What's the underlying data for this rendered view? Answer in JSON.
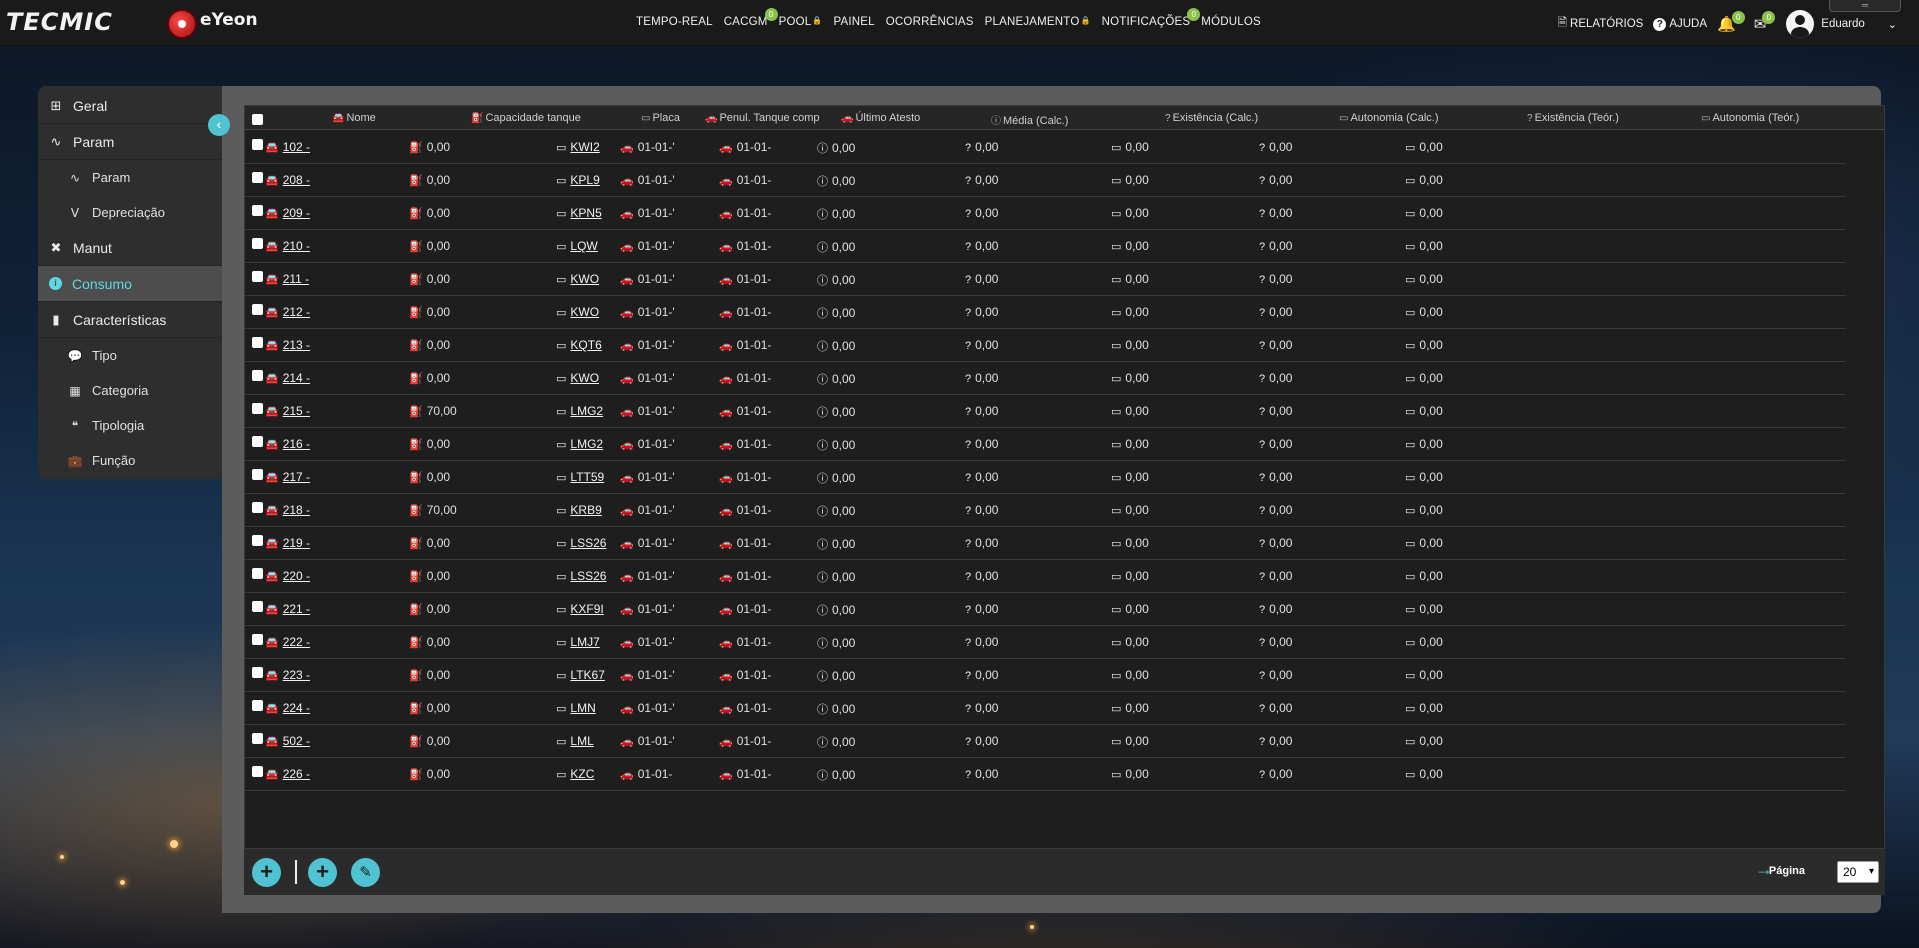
{
  "brand": {
    "tecmic": "TECMIC",
    "eyeon": "eYeon"
  },
  "topnav": [
    {
      "label": "TEMPO-REAL",
      "badge": ""
    },
    {
      "label": "CACGM",
      "badge": "0"
    },
    {
      "label": "POOL",
      "badge": ""
    },
    {
      "label": "PAINEL",
      "badge": ""
    },
    {
      "label": "OCORRÊNCIAS",
      "badge": ""
    },
    {
      "label": "PLANEJAMENTO",
      "badge": ""
    },
    {
      "label": "NOTIFICAÇÕES",
      "badge": "0"
    },
    {
      "label": "MÓDULOS",
      "badge": ""
    }
  ],
  "topright": {
    "reports": "RELATÓRIOS",
    "help": "AJUDA",
    "bell_badge": "0",
    "mail_badge": "0",
    "user": "Eduardo"
  },
  "sidebar": {
    "geral": "Geral",
    "param": "Param",
    "param_sub": "Param",
    "depreciacao": "Depreciação",
    "manut": "Manut",
    "consumo": "Consumo",
    "caracteristicas": "Características",
    "tipo": "Tipo",
    "categoria": "Categoria",
    "tipologia": "Tipologia",
    "funcao": "Função"
  },
  "table": {
    "headers": {
      "nome": "Nome",
      "capacidade": "Capacidade tanque",
      "placa": "Placa",
      "penul": "Penul. Tanque comp",
      "ultimo": "Último Atesto",
      "media": "Média (Calc.)",
      "existencia_calc": "Existência (Calc.)",
      "autonomia_calc": "Autonomia (Calc.)",
      "existencia_teor": "Existência (Teór.)",
      "autonomia_teor": "Autonomia (Teór.)"
    },
    "rows": [
      {
        "nome": "102 -",
        "capacidade": "0,00",
        "placa": "KWI2",
        "penul": "01-01-'",
        "ultimo": "01-01-",
        "media": "0,00",
        "ex_calc": "0,00",
        "aut_calc": "0,00",
        "ex_teor": "0,00",
        "aut_teor": "0,00"
      },
      {
        "nome": "208 -",
        "capacidade": "0,00",
        "placa": "KPL9",
        "penul": "01-01-'",
        "ultimo": "01-01-",
        "media": "0,00",
        "ex_calc": "0,00",
        "aut_calc": "0,00",
        "ex_teor": "0,00",
        "aut_teor": "0,00"
      },
      {
        "nome": "209 -",
        "capacidade": "0,00",
        "placa": "KPN5",
        "penul": "01-01-'",
        "ultimo": "01-01-",
        "media": "0,00",
        "ex_calc": "0,00",
        "aut_calc": "0,00",
        "ex_teor": "0,00",
        "aut_teor": "0,00"
      },
      {
        "nome": "210 -",
        "capacidade": "0,00",
        "placa": "LQW",
        "penul": "01-01-'",
        "ultimo": "01-01-",
        "media": "0,00",
        "ex_calc": "0,00",
        "aut_calc": "0,00",
        "ex_teor": "0,00",
        "aut_teor": "0,00"
      },
      {
        "nome": "211 -",
        "capacidade": "0,00",
        "placa": "KWO",
        "penul": "01-01-'",
        "ultimo": "01-01-",
        "media": "0,00",
        "ex_calc": "0,00",
        "aut_calc": "0,00",
        "ex_teor": "0,00",
        "aut_teor": "0,00"
      },
      {
        "nome": "212 -",
        "capacidade": "0,00",
        "placa": "KWO",
        "penul": "01-01-'",
        "ultimo": "01-01-",
        "media": "0,00",
        "ex_calc": "0,00",
        "aut_calc": "0,00",
        "ex_teor": "0,00",
        "aut_teor": "0,00"
      },
      {
        "nome": "213 -",
        "capacidade": "0,00",
        "placa": "KQT6",
        "penul": "01-01-'",
        "ultimo": "01-01-",
        "media": "0,00",
        "ex_calc": "0,00",
        "aut_calc": "0,00",
        "ex_teor": "0,00",
        "aut_teor": "0,00"
      },
      {
        "nome": "214 -",
        "capacidade": "0,00",
        "placa": "KWO",
        "penul": "01-01-'",
        "ultimo": "01-01-",
        "media": "0,00",
        "ex_calc": "0,00",
        "aut_calc": "0,00",
        "ex_teor": "0,00",
        "aut_teor": "0,00"
      },
      {
        "nome": "215 -",
        "capacidade": "70,00",
        "placa": "LMG2",
        "penul": "01-01-'",
        "ultimo": "01-01-",
        "media": "0,00",
        "ex_calc": "0,00",
        "aut_calc": "0,00",
        "ex_teor": "0,00",
        "aut_teor": "0,00"
      },
      {
        "nome": "216 -",
        "capacidade": "0,00",
        "placa": "LMG2",
        "penul": "01-01-'",
        "ultimo": "01-01-",
        "media": "0,00",
        "ex_calc": "0,00",
        "aut_calc": "0,00",
        "ex_teor": "0,00",
        "aut_teor": "0,00"
      },
      {
        "nome": "217 -",
        "capacidade": "0,00",
        "placa": "LTT59",
        "penul": "01-01-'",
        "ultimo": "01-01-",
        "media": "0,00",
        "ex_calc": "0,00",
        "aut_calc": "0,00",
        "ex_teor": "0,00",
        "aut_teor": "0,00"
      },
      {
        "nome": "218 -",
        "capacidade": "70,00",
        "placa": "KRB9",
        "penul": "01-01-'",
        "ultimo": "01-01-",
        "media": "0,00",
        "ex_calc": "0,00",
        "aut_calc": "0,00",
        "ex_teor": "0,00",
        "aut_teor": "0,00"
      },
      {
        "nome": "219 -",
        "capacidade": "0,00",
        "placa": "LSS26",
        "penul": "01-01-'",
        "ultimo": "01-01-",
        "media": "0,00",
        "ex_calc": "0,00",
        "aut_calc": "0,00",
        "ex_teor": "0,00",
        "aut_teor": "0,00"
      },
      {
        "nome": "220 -",
        "capacidade": "0,00",
        "placa": "LSS26",
        "penul": "01-01-'",
        "ultimo": "01-01-",
        "media": "0,00",
        "ex_calc": "0,00",
        "aut_calc": "0,00",
        "ex_teor": "0,00",
        "aut_teor": "0,00"
      },
      {
        "nome": "221 -",
        "capacidade": "0,00",
        "placa": "KXF9I",
        "penul": "01-01-'",
        "ultimo": "01-01-",
        "media": "0,00",
        "ex_calc": "0,00",
        "aut_calc": "0,00",
        "ex_teor": "0,00",
        "aut_teor": "0,00"
      },
      {
        "nome": "222 -",
        "capacidade": "0,00",
        "placa": "LMJ7",
        "penul": "01-01-'",
        "ultimo": "01-01-",
        "media": "0,00",
        "ex_calc": "0,00",
        "aut_calc": "0,00",
        "ex_teor": "0,00",
        "aut_teor": "0,00"
      },
      {
        "nome": "223 -",
        "capacidade": "0,00",
        "placa": "LTK67",
        "penul": "01-01-'",
        "ultimo": "01-01-",
        "media": "0,00",
        "ex_calc": "0,00",
        "aut_calc": "0,00",
        "ex_teor": "0,00",
        "aut_teor": "0,00"
      },
      {
        "nome": "224 -",
        "capacidade": "0,00",
        "placa": "LMN",
        "penul": "01-01-'",
        "ultimo": "01-01-",
        "media": "0,00",
        "ex_calc": "0,00",
        "aut_calc": "0,00",
        "ex_teor": "0,00",
        "aut_teor": "0,00"
      },
      {
        "nome": "502 -",
        "capacidade": "0,00",
        "placa": "LML",
        "penul": "01-01-'",
        "ultimo": "01-01-",
        "media": "0,00",
        "ex_calc": "0,00",
        "aut_calc": "0,00",
        "ex_teor": "0,00",
        "aut_teor": "0,00"
      },
      {
        "nome": "226 -",
        "capacidade": "0,00",
        "placa": "KZC",
        "penul": "01-01-",
        "ultimo": "01-01-",
        "media": "0,00",
        "ex_calc": "0,00",
        "aut_calc": "0,00",
        "ex_teor": "0,00",
        "aut_teor": "0,00"
      }
    ]
  },
  "footer": {
    "page_label": "Página",
    "page_size": "20"
  },
  "colors": {
    "accent": "#4fc3d1",
    "badge": "#8bc34a",
    "active_text": "#5ed8e6"
  }
}
